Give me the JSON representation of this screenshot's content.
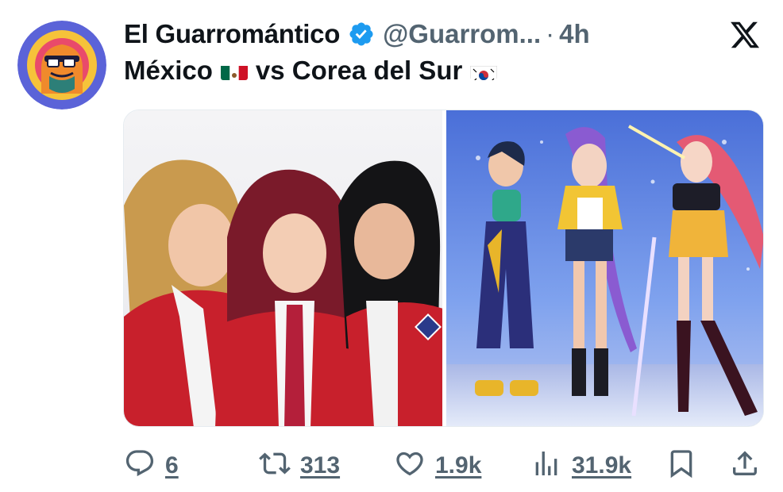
{
  "tweet": {
    "display_name": "El Guarromántico",
    "handle": "@Guarrom...",
    "separator": "·",
    "time": "4h",
    "text_part1": "México",
    "text_part2": "vs Corea del Sur",
    "flags": {
      "mexico": "mexico-flag-icon",
      "korea": "south-korea-flag-icon"
    }
  },
  "media": {
    "left_image": "three-women-in-red-school-uniforms",
    "right_image": "three-animated-kpop-characters"
  },
  "actions": {
    "replies": "6",
    "retweets": "313",
    "likes": "1.9k",
    "views": "31.9k"
  },
  "colors": {
    "text_primary": "#0f1419",
    "text_secondary": "#536471",
    "verified_blue": "#1d9bf0",
    "avatar_bg": "#5b63d8"
  }
}
